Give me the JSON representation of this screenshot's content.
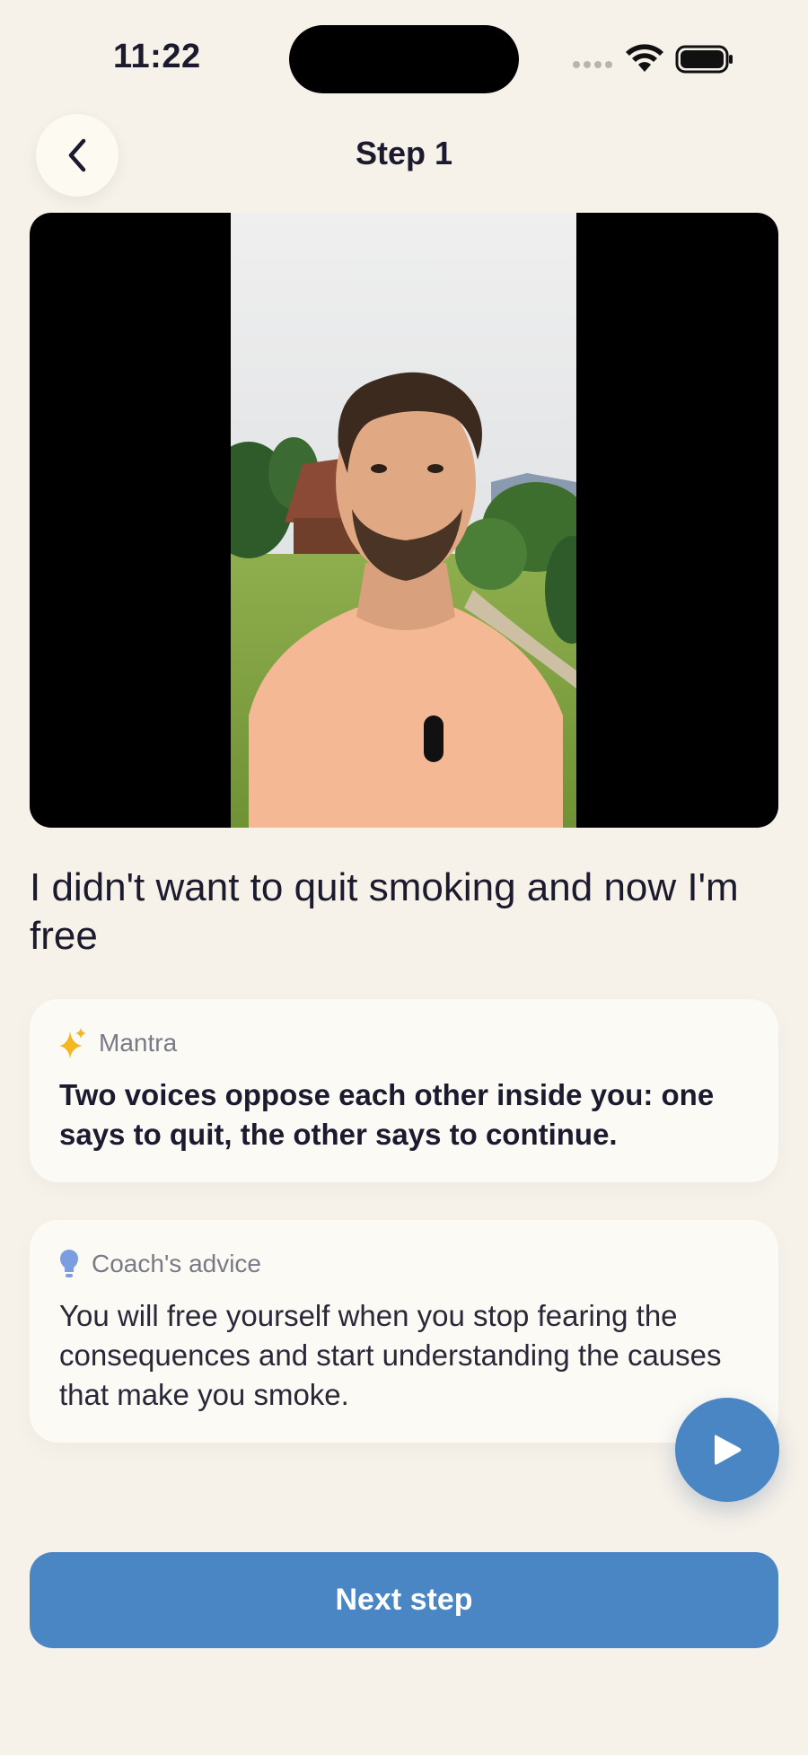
{
  "status_bar": {
    "time": "11:22"
  },
  "header": {
    "title": "Step 1"
  },
  "video": {
    "headline": "I didn't want to quit smoking and now I'm free"
  },
  "mantra": {
    "label": "Mantra",
    "text": "Two voices oppose each other inside you: one says to quit, the other says to continue."
  },
  "advice": {
    "label": "Coach's advice",
    "text": "You will free yourself when you stop fearing the consequences and start understanding the causes that make you smoke."
  },
  "actions": {
    "next_label": "Next step"
  },
  "colors": {
    "background": "#f6f1e9",
    "accent": "#4a86c4",
    "card": "#fcfaf5",
    "sparkle": "#f2b824",
    "bulb": "#7c9ee0"
  },
  "icons": [
    "back-chevron-icon",
    "sparkle-icon",
    "lightbulb-icon",
    "play-icon",
    "wifi-icon",
    "battery-icon"
  ]
}
